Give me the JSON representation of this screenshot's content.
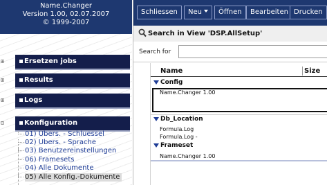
{
  "app": {
    "name": "Name.Changer",
    "version": "Version 1.00, 02.07.2007",
    "copyright": "© 1999-2007"
  },
  "nav": {
    "sections": [
      {
        "label": "Ersetzen jobs",
        "expanded": false
      },
      {
        "label": "Results",
        "expanded": false
      },
      {
        "label": "Logs",
        "expanded": false
      },
      {
        "label": "Konfiguration",
        "expanded": true
      }
    ],
    "config_items": [
      {
        "label": "01) Übers. - Schluessel",
        "selected": false
      },
      {
        "label": "02) Übers. - Sprache",
        "selected": false
      },
      {
        "label": "03) Benutzereinstellungen",
        "selected": false
      },
      {
        "label": "06) Framesets",
        "selected": false
      },
      {
        "label": "04) Alle Dokumente",
        "selected": false
      },
      {
        "label": "05) Alle Konfig.-Dokumente",
        "selected": true
      }
    ]
  },
  "toolbar": {
    "buttons": [
      {
        "label": "Schliessen"
      },
      {
        "label": "Neu",
        "has_menu": true
      },
      {
        "label": "Öffnen"
      },
      {
        "label": "Bearbeiten"
      },
      {
        "label": "Drucken"
      }
    ]
  },
  "view": {
    "title": "Search in View 'DSP.AllSetup'",
    "search_label": "Search for",
    "search_value": "",
    "columns": [
      "Name",
      "Size"
    ],
    "categories": [
      {
        "label": "Config",
        "rows": [
          "Name.Changer 1.00"
        ]
      },
      {
        "label": "Db_Location",
        "rows": [
          "Formula.Log",
          "Formula.Log -"
        ]
      },
      {
        "label": "Frameset",
        "rows": [
          "Name.Changer 1.00"
        ]
      }
    ]
  },
  "colors": {
    "header_bg": "#1e3870",
    "section_bar": "#141e4b",
    "link": "#1e3c96"
  }
}
